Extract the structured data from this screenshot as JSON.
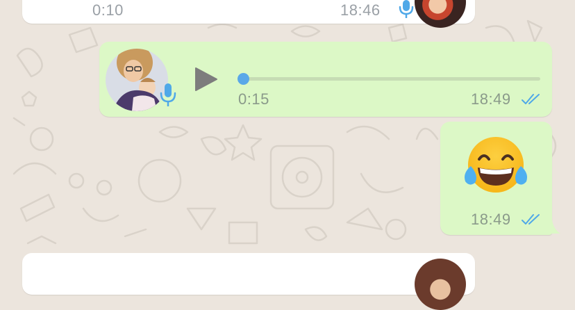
{
  "colors": {
    "chat_background": "#ece5dd",
    "incoming_bubble": "#ffffff",
    "outgoing_bubble": "#dcf8c6",
    "read_receipt": "#4fa8e8",
    "mic_blue": "#4fa8e8",
    "play_button": "#7d7d7d"
  },
  "messages": [
    {
      "type": "voice",
      "direction": "incoming",
      "duration": "0:10",
      "time": "18:46",
      "icons": [
        "avatar",
        "mic-icon"
      ]
    },
    {
      "type": "voice",
      "direction": "outgoing",
      "duration": "0:15",
      "time": "18:49",
      "progress": 0.0,
      "status": "read",
      "icons": [
        "avatar",
        "mic-icon",
        "play-icon",
        "double-check-icon"
      ]
    },
    {
      "type": "emoji",
      "direction": "outgoing",
      "emoji": "😂",
      "emoji_name": "face-with-tears-of-joy",
      "time": "18:49",
      "status": "read",
      "icons": [
        "double-check-icon"
      ]
    },
    {
      "type": "voice",
      "direction": "incoming",
      "icons": [
        "avatar"
      ]
    }
  ]
}
